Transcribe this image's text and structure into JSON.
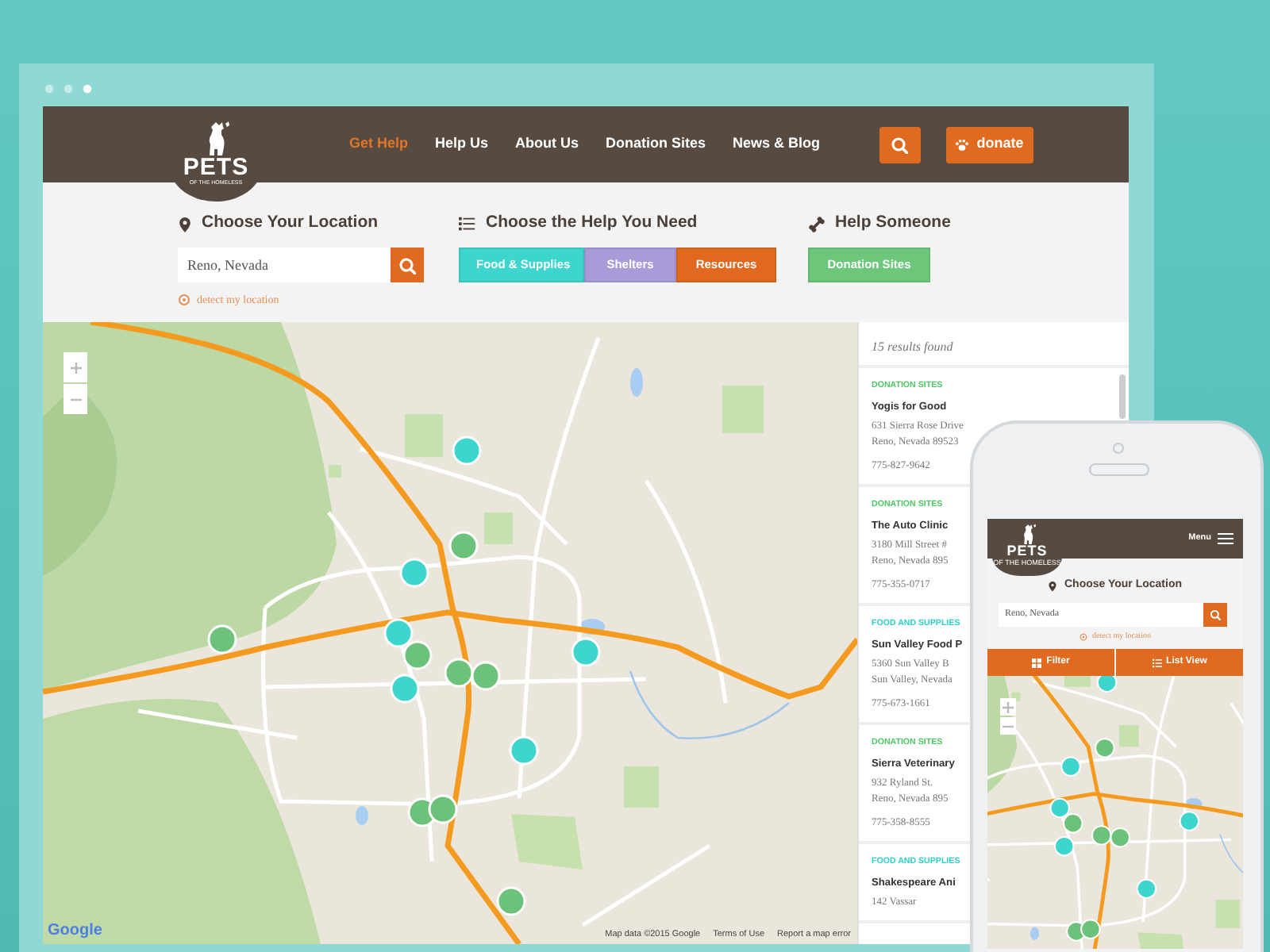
{
  "browser": {
    "nav": {
      "logo": {
        "title": "PETS",
        "subtitle": "OF THE HOMELESS"
      },
      "links": [
        {
          "label": "Get Help",
          "selected": true
        },
        {
          "label": "Help Us",
          "selected": false
        },
        {
          "label": "About Us",
          "selected": false
        },
        {
          "label": "Donation Sites",
          "selected": false
        },
        {
          "label": "News & Blog",
          "selected": false
        }
      ],
      "donate_button": "donate"
    },
    "filters": {
      "location": {
        "heading": "Choose Your Location",
        "value": "Reno, Nevada",
        "detect_link": "detect my location"
      },
      "help_need": {
        "heading": "Choose the Help You Need",
        "buttons": [
          {
            "label": "Food & Supplies",
            "color": "#3dd5cd"
          },
          {
            "label": "Shelters",
            "color": "#a99bd8"
          },
          {
            "label": "Resources",
            "color": "#e0691f"
          }
        ]
      },
      "help_someone": {
        "heading": "Help Someone",
        "buttons": [
          {
            "label": "Donation Sites",
            "color": "#6cc77b"
          }
        ]
      }
    },
    "map": {
      "markers": [
        {
          "color": "#3dd5cd"
        },
        {
          "color": "#6cc27a"
        },
        {
          "color": "#3dd5cd"
        },
        {
          "color": "#6cc27a"
        },
        {
          "color": "#3dd5cd"
        },
        {
          "color": "#6cc27a"
        },
        {
          "color": "#6cc27a"
        },
        {
          "color": "#6cc27a"
        },
        {
          "color": "#3dd5cd"
        },
        {
          "color": "#3dd5cd"
        },
        {
          "color": "#3dd5cd"
        },
        {
          "color": "#6cc27a"
        },
        {
          "color": "#6cc27a"
        },
        {
          "color": "#6cc27a"
        }
      ],
      "logo": "Google",
      "attribution": [
        "Map data ©2015 Google",
        "Terms of Use",
        "Report a map error"
      ]
    },
    "results": {
      "count": "15 results found",
      "items": [
        {
          "category": "DONATION SITES",
          "color": "#4fc766",
          "name": "Yogis for Good",
          "address_lines": [
            "631 Sierra Rose Drive",
            "Reno, Nevada 89523"
          ],
          "phone": "775-827-9642"
        },
        {
          "category": "DONATION SITES",
          "color": "#4fc766",
          "name": "The Auto Clinic",
          "address_lines": [
            "3180 Mill Street #",
            "Reno, Nevada 895"
          ],
          "phone": "775-355-0717"
        },
        {
          "category": "FOOD AND SUPPLIES",
          "color": "#2fcfc6",
          "name": "Sun Valley Food P",
          "address_lines": [
            "5360 Sun Valley B",
            "Sun Valley, Nevada"
          ],
          "phone": "775-673-1661"
        },
        {
          "category": "DONATION SITES",
          "color": "#4fc766",
          "name": "Sierra Veterinary",
          "address_lines": [
            "932 Ryland St.",
            "Reno, Nevada 895"
          ],
          "phone": "775-358-8555"
        },
        {
          "category": "FOOD AND SUPPLIES",
          "color": "#2fcfc6",
          "name": "Shakespeare Ani",
          "address_lines": [
            "142 Vassar"
          ]
        }
      ]
    }
  },
  "phone": {
    "nav": {
      "logo": {
        "title": "PETS",
        "subtitle": "OF THE HOMELESS"
      },
      "menu_label": "Menu"
    },
    "location": {
      "heading": "Choose Your Location",
      "value": "Reno, Nevada",
      "detect_link": "detect my location"
    },
    "buttons": [
      {
        "kind": "filter",
        "label": "Filter"
      },
      {
        "kind": "list",
        "label": "List View"
      }
    ],
    "map": {
      "markers": [
        {
          "color": "#3dd5cd"
        },
        {
          "color": "#6cc27a"
        },
        {
          "color": "#3dd5cd"
        },
        {
          "color": "#3dd5cd"
        },
        {
          "color": "#6cc27a"
        },
        {
          "color": "#6cc27a"
        },
        {
          "color": "#6cc27a"
        },
        {
          "color": "#3dd5cd"
        },
        {
          "color": "#3dd5cd"
        },
        {
          "color": "#3dd5cd"
        },
        {
          "color": "#6cc27a"
        },
        {
          "color": "#6cc27a"
        }
      ]
    }
  }
}
